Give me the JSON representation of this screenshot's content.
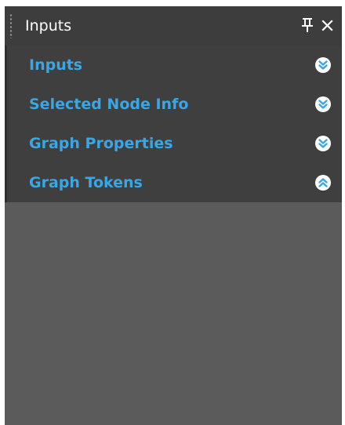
{
  "panel": {
    "title": "Inputs",
    "pin_icon": "pin-icon",
    "close_icon": "close-icon"
  },
  "sections": [
    {
      "label": "Inputs",
      "state": "collapsed",
      "icon": "chevron-double-down-icon"
    },
    {
      "label": "Selected Node Info",
      "state": "collapsed",
      "icon": "chevron-double-down-icon"
    },
    {
      "label": "Graph Properties",
      "state": "collapsed",
      "icon": "chevron-double-down-icon"
    },
    {
      "label": "Graph Tokens",
      "state": "expanded",
      "icon": "chevron-double-up-icon"
    }
  ],
  "colors": {
    "titlebar": "#3d3d3d",
    "section_bg": "#3f3f3f",
    "panel_bg": "#5b5b5b",
    "accent": "#3aa6e3"
  }
}
